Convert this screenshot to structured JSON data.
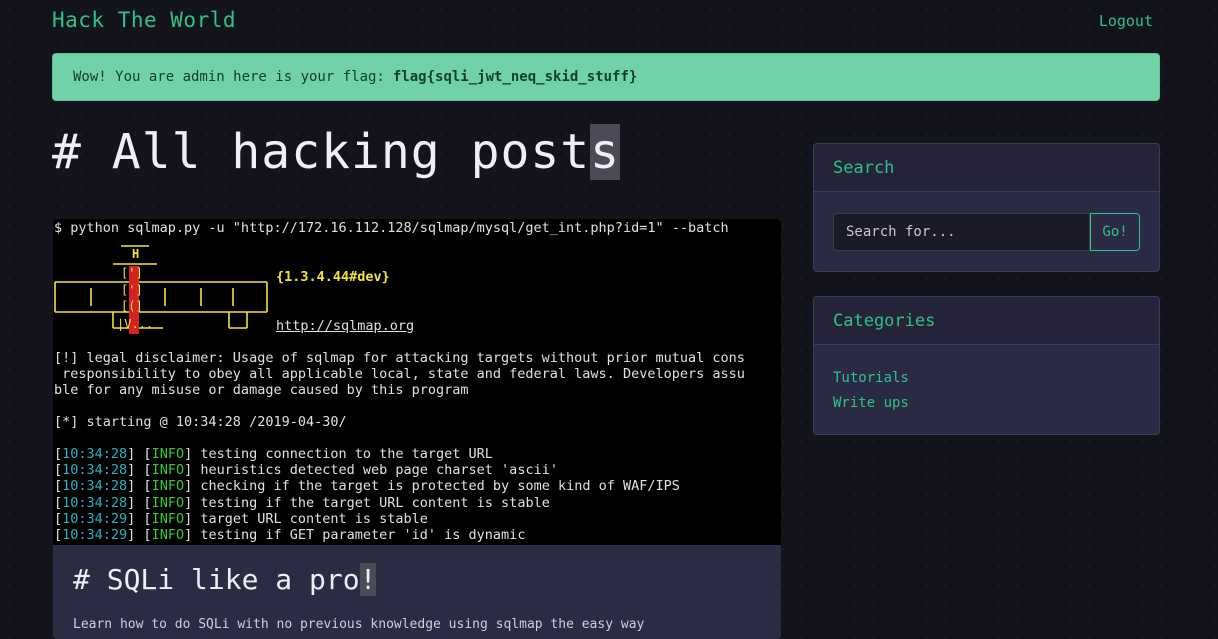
{
  "nav": {
    "brand": "Hack The World",
    "logout": "Logout"
  },
  "alert": {
    "message": "Wow! You are admin here is your flag:",
    "flag": "flag{sqli_jwt_neq_skid_stuff}"
  },
  "page": {
    "title": "# All hacking posts",
    "title_cursor_char": "s"
  },
  "post": {
    "image": {
      "command": "$ python sqlmap.py -u \"http://172.16.112.128/sqlmap/mysql/get_int.php?id=1\" --batch",
      "version": "{1.3.4.44#dev}",
      "url": "http://sqlmap.org",
      "disclaimer": [
        "[!] legal disclaimer: Usage of sqlmap for attacking targets without prior mutual cons",
        " responsibility to obey all applicable local, state and federal laws. Developers assu",
        "ble for any misuse or damage caused by this program"
      ],
      "starting": "[*] starting @ 10:34:28 /2019-04-30/",
      "log": [
        {
          "time": "10:34:28",
          "level": "INFO",
          "message": "testing connection to the target URL"
        },
        {
          "time": "10:34:28",
          "level": "INFO",
          "message": "heuristics detected web page charset 'ascii'"
        },
        {
          "time": "10:34:28",
          "level": "INFO",
          "message": "checking if the target is protected by some kind of WAF/IPS"
        },
        {
          "time": "10:34:28",
          "level": "INFO",
          "message": "testing if the target URL content is stable"
        },
        {
          "time": "10:34:29",
          "level": "INFO",
          "message": "target URL content is stable"
        },
        {
          "time": "10:34:29",
          "level": "INFO",
          "message": "testing if GET parameter 'id' is dynamic"
        }
      ]
    },
    "title": "# SQLi like a pro",
    "title_cursor_char": "!",
    "excerpt": "Learn how to do SQLi with no previous knowledge using sqlmap the easy way"
  },
  "sidebar": {
    "search": {
      "title": "Search",
      "placeholder": "Search for...",
      "button": "Go!"
    },
    "categories": {
      "title": "Categories",
      "items": [
        "Tutorials",
        "Write ups"
      ]
    }
  },
  "colors": {
    "accent": "#2ec386",
    "alert_bg": "#72d2a7",
    "card_bg": "#2c2b44",
    "page_bg": "#13131c"
  }
}
